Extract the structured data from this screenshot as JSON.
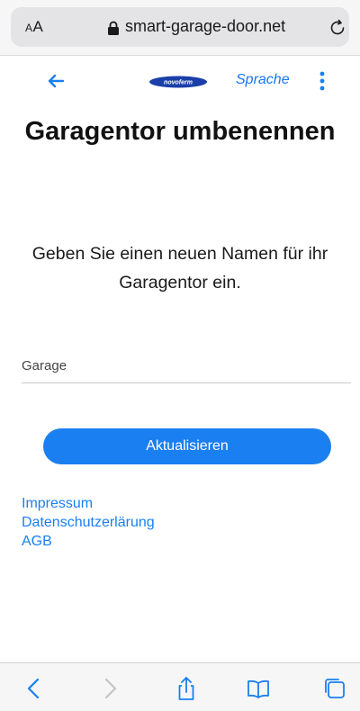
{
  "browser": {
    "text_size_label": "AA",
    "url": "smart-garage-door.net"
  },
  "header": {
    "logo_text": "novoferm",
    "language_label": "Sprache"
  },
  "page": {
    "title": "Garagentor umbenennen",
    "instruction": "Geben Sie einen neuen Namen für ihr Garagentor ein.",
    "name_placeholder": "Garage",
    "submit_label": "Aktualisieren"
  },
  "footer": {
    "links": [
      "Impressum",
      "Datenschutzerlärung",
      "AGB"
    ]
  },
  "colors": {
    "accent": "#1a7ff1",
    "logo_blue": "#1a3fa8"
  },
  "icons": [
    "lock-icon",
    "reload-icon",
    "back-arrow-icon",
    "more-vertical-icon",
    "chevron-left-icon",
    "chevron-right-icon",
    "share-icon",
    "bookmarks-icon",
    "tabs-icon"
  ]
}
